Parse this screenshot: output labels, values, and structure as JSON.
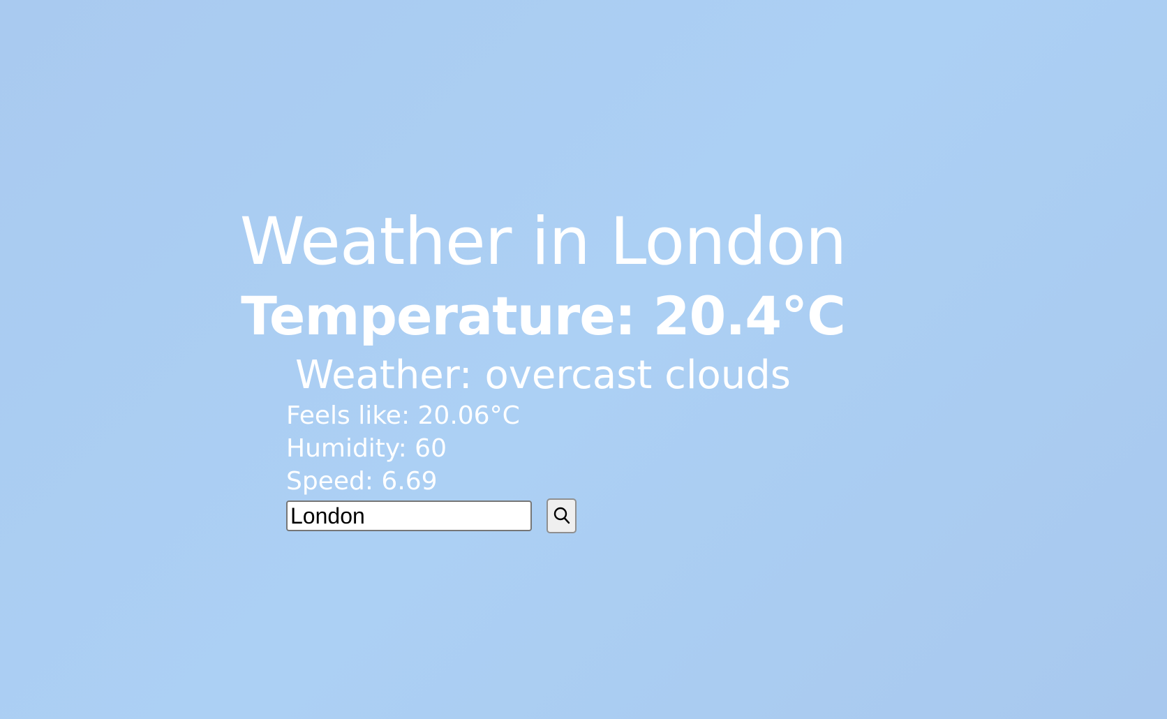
{
  "weather": {
    "title": "Weather in London",
    "temperature": "Temperature: 20.4°C",
    "description": "Weather: overcast clouds",
    "feels_like": "Feels like: 20.06°C",
    "humidity": "Humidity: 60",
    "speed": "Speed: 6.69"
  },
  "search": {
    "value": "London",
    "button_icon": "search-icon"
  },
  "colors": {
    "background": "#aacbf1",
    "text": "#ffffff"
  }
}
